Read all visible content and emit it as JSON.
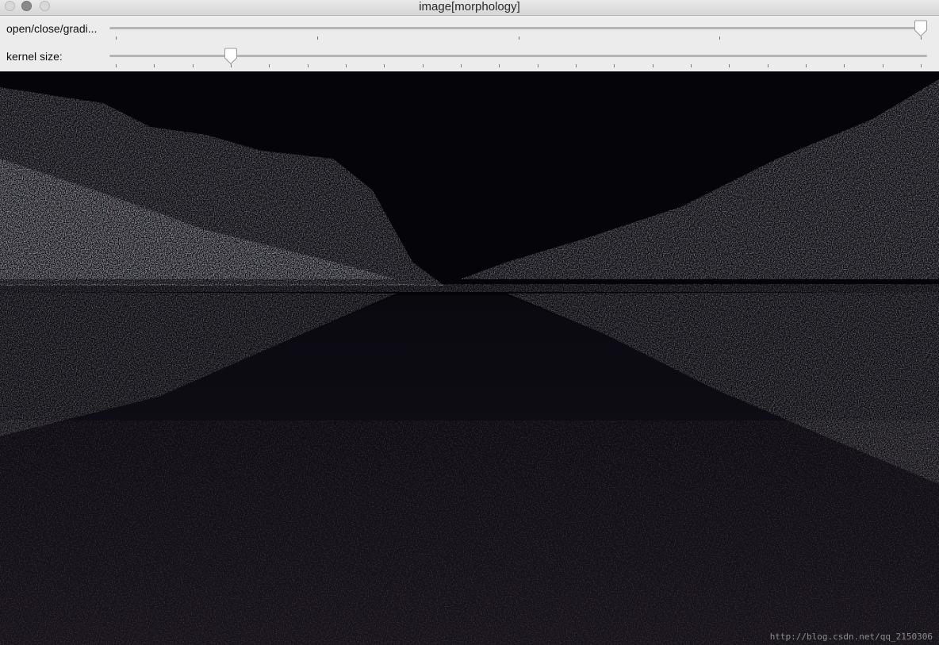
{
  "window": {
    "title": "image[morphology]"
  },
  "controls": [
    {
      "label": "open/close/gradi...",
      "ticks": 5,
      "value_fraction": 1.0
    },
    {
      "label": "kernel size:",
      "ticks": 22,
      "value_fraction": 0.1429
    }
  ],
  "image": {
    "description_icon": "morphology-gradient-image",
    "watermark": "http://blog.csdn.net/qq_2150306"
  },
  "colors": {
    "image_background": "#050409",
    "panel_background": "#ececec"
  }
}
